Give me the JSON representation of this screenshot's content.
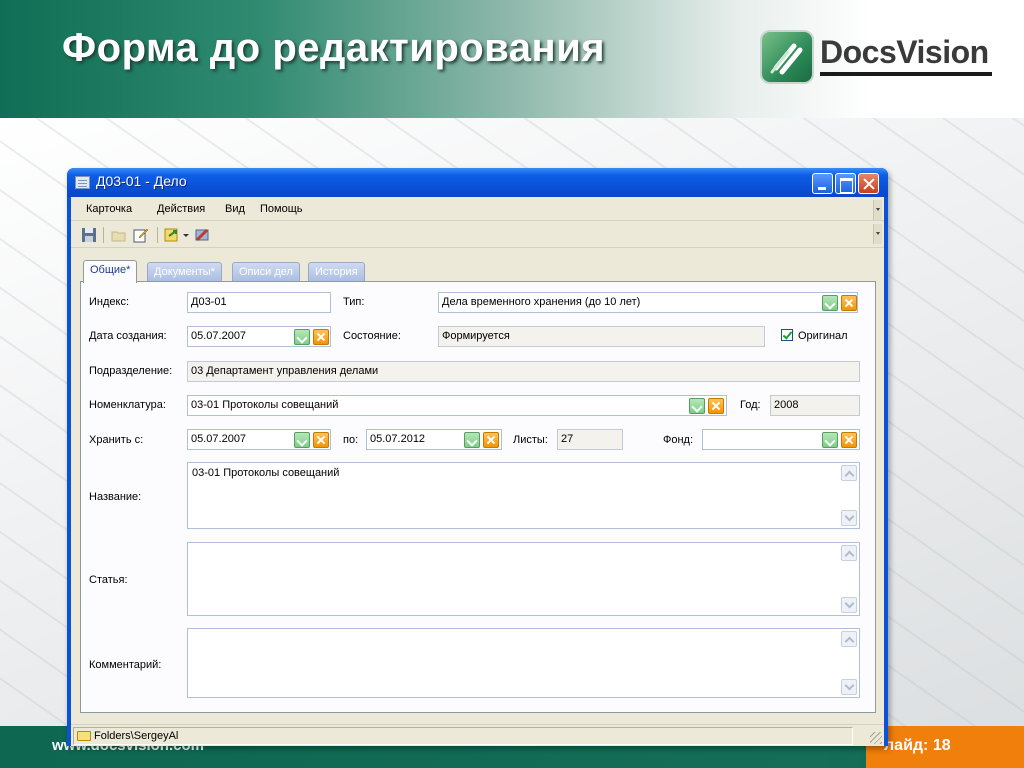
{
  "slide": {
    "title": "Форма до редактирования",
    "logo_text": "DocsVision",
    "footer_url": "www.docsvision.com",
    "slide_number": "лайд: 18"
  },
  "window": {
    "title": "Д03-01 - Дело",
    "menu": [
      "Карточка",
      "Действия",
      "Вид",
      "Помощь"
    ],
    "toolbar_icons": [
      "save-icon",
      "open-icon",
      "edit-icon",
      "export-icon",
      "dropdown-arrow-icon",
      "tools-icon"
    ],
    "tabs": [
      "Общие*",
      "Документы*",
      "Описи дел",
      "История"
    ],
    "active_tab": "Общие*",
    "status_path": "Folders\\SergeyAl"
  },
  "form": {
    "index": {
      "label": "Индекс:",
      "value": "Д03-01"
    },
    "type": {
      "label": "Тип:",
      "value": "Дела временного хранения (до 10 лет)"
    },
    "created": {
      "label": "Дата создания:",
      "value": "05.07.2007"
    },
    "state": {
      "label": "Состояние:",
      "value": "Формируется"
    },
    "original": {
      "label": "Оригинал",
      "checked": true
    },
    "department": {
      "label": "Подразделение:",
      "value": "03 Департамент управления делами"
    },
    "nomenclature": {
      "label": "Номенклатура:",
      "value": "03-01 Протоколы совещаний"
    },
    "year": {
      "label": "Год:",
      "value": "2008"
    },
    "keep_from": {
      "label": "Хранить с:",
      "value": "05.07.2007"
    },
    "keep_to": {
      "label": "по:",
      "value": "05.07.2012"
    },
    "sheets": {
      "label": "Листы:",
      "value": "27"
    },
    "fund": {
      "label": "Фонд:",
      "value": ""
    },
    "name": {
      "label": "Название:",
      "value": "03-01 Протоколы совещаний"
    },
    "article": {
      "label": "Статья:",
      "value": ""
    },
    "comment": {
      "label": "Комментарий:",
      "value": ""
    }
  },
  "colors": {
    "header_green": "#0f6e55",
    "footer_orange": "#f07f0b",
    "window_blue": "#0a52d8",
    "dialog_bg": "#ece9d8"
  }
}
